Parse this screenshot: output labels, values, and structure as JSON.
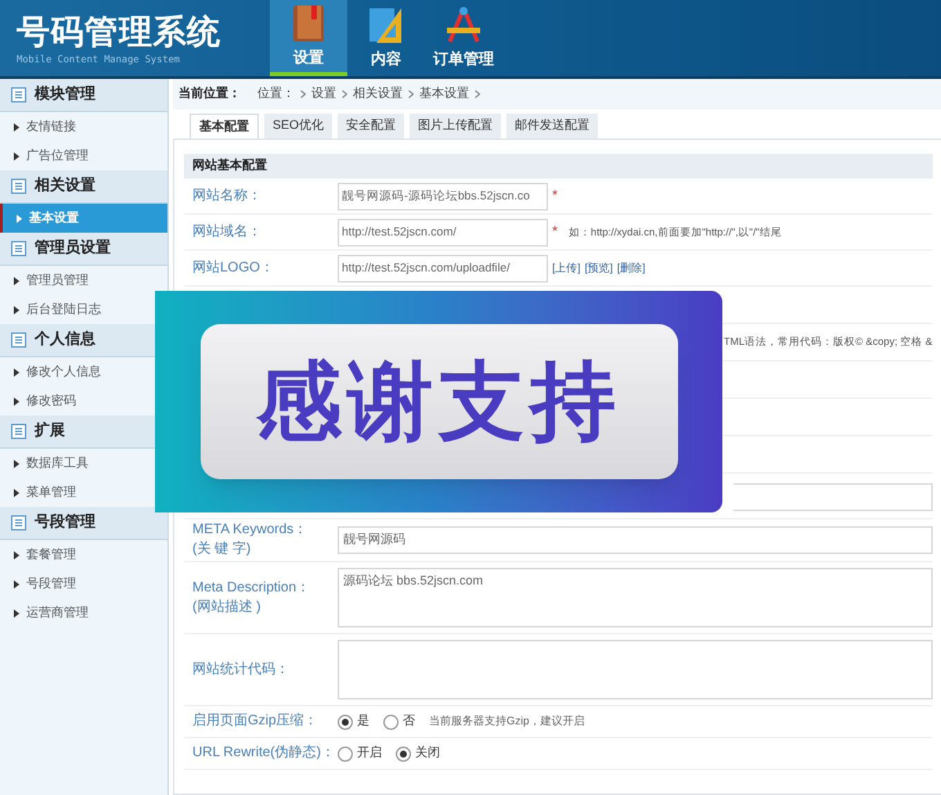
{
  "header": {
    "title": "号码管理系统",
    "subtitle": "Mobile Content Manage System",
    "nav": [
      {
        "label": "设置",
        "selected": true
      },
      {
        "label": "内容",
        "selected": false
      },
      {
        "label": "订单管理",
        "selected": false
      }
    ]
  },
  "sidebar": [
    {
      "title": "模块管理",
      "items": [
        {
          "label": "友情链接",
          "selected": false
        },
        {
          "label": "广告位管理",
          "selected": false
        }
      ]
    },
    {
      "title": "相关设置",
      "items": [
        {
          "label": "基本设置",
          "selected": true
        }
      ]
    },
    {
      "title": "管理员设置",
      "items": [
        {
          "label": "管理员管理",
          "selected": false
        },
        {
          "label": "后台登陆日志",
          "selected": false
        }
      ]
    },
    {
      "title": "个人信息",
      "items": [
        {
          "label": "修改个人信息",
          "selected": false
        },
        {
          "label": "修改密码",
          "selected": false
        }
      ]
    },
    {
      "title": "扩展",
      "items": [
        {
          "label": "数据库工具",
          "selected": false
        },
        {
          "label": "菜单管理",
          "selected": false
        }
      ]
    },
    {
      "title": "号段管理",
      "items": [
        {
          "label": "套餐管理",
          "selected": false
        },
        {
          "label": "号段管理",
          "selected": false
        },
        {
          "label": "运营商管理",
          "selected": false
        }
      ]
    }
  ],
  "breadcrumb": {
    "label": "当前位置：",
    "items": [
      "位置：",
      "设置",
      "相关设置",
      "基本设置"
    ]
  },
  "tabs": [
    {
      "label": "基本配置",
      "selected": true
    },
    {
      "label": "SEO优化",
      "selected": false
    },
    {
      "label": "安全配置",
      "selected": false
    },
    {
      "label": "图片上传配置",
      "selected": false
    },
    {
      "label": "邮件发送配置",
      "selected": false
    }
  ],
  "section_title": "网站基本配置",
  "rows_top": [
    {
      "kind": "input",
      "label": "网站名称：",
      "value": "靓号网源码-源码论坛bbs.52jscn.co",
      "required_mark": "*"
    },
    {
      "kind": "input",
      "label": "网站域名：",
      "value": "http://test.52jscn.com/",
      "required_mark": "*",
      "hint": "如：http://xydai.cn,前面要加\"http://\",以\"/\"结尾"
    },
    {
      "kind": "upload",
      "label": "网站LOGO：",
      "value": "http://test.52jscn.com/uploadfile/",
      "links": [
        "[上传]",
        "[预览]",
        "[删除]"
      ]
    }
  ],
  "covered_hint": "TML语法，常用代码：版权© &copy; 空格 &",
  "rows_bottom": [
    {
      "kind": "covered_input"
    },
    {
      "kind": "input",
      "label_lines": [
        "META Keywords：",
        "(关 键 字)"
      ],
      "value": "靓号网源码"
    },
    {
      "kind": "textarea",
      "label_lines": [
        "Meta Description：",
        "(网站描述 )"
      ],
      "value": "源码论坛 bbs.52jscn.com"
    },
    {
      "kind": "textarea",
      "label_lines": [
        "网站统计代码："
      ]
    },
    {
      "kind": "radio",
      "label_lines": [
        "启用页面Gzip压缩："
      ],
      "options": [
        {
          "label": "是",
          "selected": true
        },
        {
          "label": "否",
          "selected": false
        }
      ],
      "hint": "当前服务器支持Gzip，建议开启"
    },
    {
      "kind": "radio",
      "label_lines": [
        "URL Rewrite(伪静态)："
      ],
      "options": [
        {
          "label": "开启",
          "selected": false
        },
        {
          "label": "关闭",
          "selected": true
        }
      ]
    }
  ],
  "overlay": {
    "text": "感谢支持"
  }
}
